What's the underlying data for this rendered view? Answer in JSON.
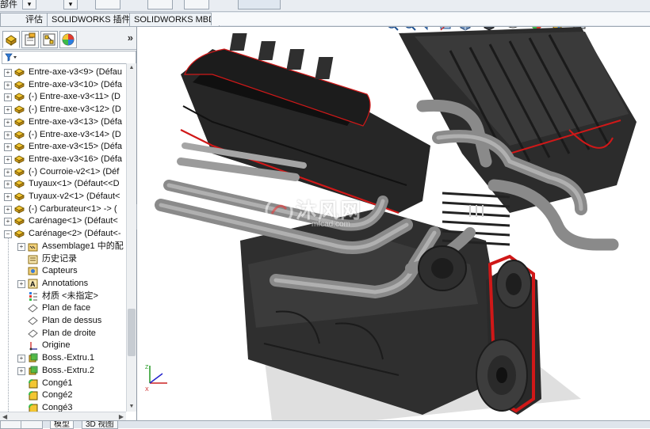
{
  "top": {
    "partial_label": "部件",
    "buttons": [
      "▾",
      "▾",
      "",
      "",
      "",
      "",
      "",
      ""
    ]
  },
  "tabs": [
    "评估",
    "SOLIDWORKS 插件",
    "SOLIDWORKS MBD"
  ],
  "feature_manager": {
    "panel_tabs": [
      "feature-manager-icon",
      "property-manager-icon",
      "configuration-manager-icon",
      "display-manager-icon"
    ],
    "more": "»",
    "filter_icon": "funnel-icon",
    "tree": [
      {
        "label": "Entre-axe-v3<9> (Défau",
        "icon": "part-icon",
        "level": 0,
        "exp": "+"
      },
      {
        "label": "Entre-axe-v3<10> (Défa",
        "icon": "part-icon",
        "level": 0,
        "exp": "+"
      },
      {
        "label": "(-) Entre-axe-v3<11> (D",
        "icon": "part-icon",
        "level": 0,
        "exp": "+"
      },
      {
        "label": "(-) Entre-axe-v3<12> (D",
        "icon": "part-icon",
        "level": 0,
        "exp": "+"
      },
      {
        "label": "Entre-axe-v3<13> (Défa",
        "icon": "part-icon",
        "level": 0,
        "exp": "+"
      },
      {
        "label": "(-) Entre-axe-v3<14> (D",
        "icon": "part-icon",
        "level": 0,
        "exp": "+"
      },
      {
        "label": "Entre-axe-v3<15> (Défa",
        "icon": "part-icon",
        "level": 0,
        "exp": "+"
      },
      {
        "label": "Entre-axe-v3<16> (Défa",
        "icon": "part-icon",
        "level": 0,
        "exp": "+"
      },
      {
        "label": "(-) Courroie-v2<1> (Déf",
        "icon": "part-icon",
        "level": 0,
        "exp": "+"
      },
      {
        "label": "Tuyaux<1> (Défaut<<D",
        "icon": "part-icon",
        "level": 0,
        "exp": "+"
      },
      {
        "label": "Tuyaux-v2<1> (Défaut<",
        "icon": "part-icon",
        "level": 0,
        "exp": "+"
      },
      {
        "label": "(-) Carburateur<1> -> (",
        "icon": "part-icon",
        "level": 0,
        "exp": "+"
      },
      {
        "label": "Carénage<1> (Défaut<",
        "icon": "part-icon",
        "level": 0,
        "exp": "+"
      },
      {
        "label": "Carénage<2> (Défaut<-",
        "icon": "part-icon",
        "level": 0,
        "exp": "-"
      },
      {
        "label": "Assemblage1 中的配",
        "icon": "mates-folder-icon",
        "level": 1,
        "exp": "+"
      },
      {
        "label": "历史记录",
        "icon": "history-icon",
        "level": 1,
        "exp": ""
      },
      {
        "label": "Capteurs",
        "icon": "sensors-icon",
        "level": 1,
        "exp": ""
      },
      {
        "label": "Annotations",
        "icon": "annotations-icon",
        "level": 1,
        "exp": "+"
      },
      {
        "label": "材质 <未指定>",
        "icon": "material-icon",
        "level": 1,
        "exp": ""
      },
      {
        "label": "Plan de face",
        "icon": "plane-icon",
        "level": 1,
        "exp": ""
      },
      {
        "label": "Plan de dessus",
        "icon": "plane-icon",
        "level": 1,
        "exp": ""
      },
      {
        "label": "Plan de droite",
        "icon": "plane-icon",
        "level": 1,
        "exp": ""
      },
      {
        "label": "Origine",
        "icon": "origin-icon",
        "level": 1,
        "exp": ""
      },
      {
        "label": "Boss.-Extru.1",
        "icon": "extrude-icon",
        "level": 1,
        "exp": "+"
      },
      {
        "label": "Boss.-Extru.2",
        "icon": "extrude-icon",
        "level": 1,
        "exp": "+"
      },
      {
        "label": "Congé1",
        "icon": "fillet-icon",
        "level": 1,
        "exp": ""
      },
      {
        "label": "Congé2",
        "icon": "fillet-icon",
        "level": 1,
        "exp": ""
      },
      {
        "label": "Congé3",
        "icon": "fillet-icon",
        "level": 1,
        "exp": ""
      }
    ]
  },
  "bottom_tabs": [
    "",
    "",
    "模型",
    "3D 视图"
  ],
  "viewport": {
    "hud_icons": [
      "zoom-to-fit-icon",
      "zoom-area-icon",
      "previous-view-icon",
      "section-view-icon",
      "view-orientation-icon",
      "display-style-icon",
      "hide-show-icon",
      "appearance-icon",
      "scene-icon",
      "view-settings-icon"
    ],
    "watermark": {
      "text": "沐风网",
      "url": "mfcad.com"
    },
    "colors": {
      "engine_dark": "#2b2b2b",
      "engine_mid": "#3d3d3d",
      "pipe": "#8e8e8e",
      "accent_red": "#d01818",
      "shadow": "#c9c9c9"
    }
  }
}
